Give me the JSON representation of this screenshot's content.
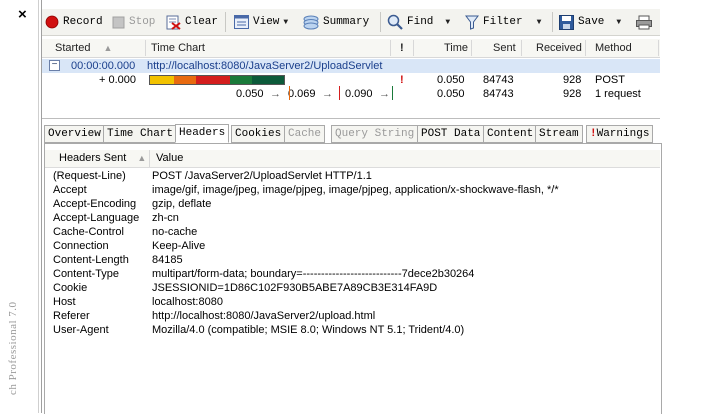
{
  "window": {
    "close_glyph": "×",
    "product_label": "ch Professional 7.0"
  },
  "toolbar": {
    "record": "Record",
    "stop": "Stop",
    "clear": "Clear",
    "view": "View",
    "summary": "Summary",
    "find": "Find",
    "filter": "Filter",
    "save": "Save"
  },
  "grid": {
    "columns": {
      "started": "Started",
      "time_chart": "Time Chart",
      "flag": "!",
      "time": "Time",
      "sent": "Sent",
      "received": "Received",
      "method": "Method"
    },
    "rows": [
      {
        "started": "00:00:00.000",
        "chart": "http://localhost:8080/JavaServer2/UploadServlet",
        "flag": "",
        "time": "",
        "sent": "",
        "received": "",
        "method": "",
        "toggle": "−"
      },
      {
        "started": "+ 0.000",
        "chart": "",
        "flag": "!",
        "time": "0.050",
        "sent": "84743",
        "received": "928",
        "method": "POST"
      },
      {
        "started": "",
        "chart_marks": [
          "0.050",
          "0.069",
          "0.090"
        ],
        "time": "0.050",
        "sent": "84743",
        "received": "928",
        "method": "1 request"
      }
    ]
  },
  "tabs": [
    {
      "label": "Overview",
      "active": false,
      "enabled": true
    },
    {
      "label": "Time Chart",
      "active": false,
      "enabled": true
    },
    {
      "label": "Headers",
      "active": true,
      "enabled": true
    },
    {
      "label": "Cookies",
      "active": false,
      "enabled": true
    },
    {
      "label": "Cache",
      "active": false,
      "enabled": false
    },
    {
      "label": "Query String",
      "active": false,
      "enabled": false
    },
    {
      "label": "POST Data",
      "active": false,
      "enabled": true
    },
    {
      "label": "Content",
      "active": false,
      "enabled": true
    },
    {
      "label": "Stream",
      "active": false,
      "enabled": true
    },
    {
      "label": "Warnings",
      "active": false,
      "enabled": true
    }
  ],
  "headers_pane": {
    "col_name": "Headers Sent",
    "col_value": "Value",
    "rows": [
      {
        "name": "(Request-Line)",
        "value": "POST /JavaServer2/UploadServlet HTTP/1.1"
      },
      {
        "name": "Accept",
        "value": "image/gif, image/jpeg, image/pjpeg, image/pjpeg, application/x-shockwave-flash, */*"
      },
      {
        "name": "Accept-Encoding",
        "value": "gzip, deflate"
      },
      {
        "name": "Accept-Language",
        "value": "zh-cn"
      },
      {
        "name": "Cache-Control",
        "value": "no-cache"
      },
      {
        "name": "Connection",
        "value": "Keep-Alive"
      },
      {
        "name": "Content-Length",
        "value": "84185"
      },
      {
        "name": "Content-Type",
        "value": "multipart/form-data; boundary=---------------------------7dece2b30264"
      },
      {
        "name": "Cookie",
        "value": "JSESSIONID=1D86C102F930B5ABE7A89CB3E314FA9D"
      },
      {
        "name": "Host",
        "value": "localhost:8080"
      },
      {
        "name": "Referer",
        "value": "http://localhost:8080/JavaServer2/upload.html"
      },
      {
        "name": "User-Agent",
        "value": "Mozilla/4.0 (compatible; MSIE 8.0; Windows NT 5.1; Trident/4.0)"
      }
    ]
  },
  "colors": {
    "selected_row": "#d9e6f7",
    "record_red": "#d01010",
    "warning_red": "#d01010",
    "timing_segments": [
      "#ffffff",
      "#f2c200",
      "#e86a10",
      "#d41e1e",
      "#1a7a3a",
      "#0c5a3a"
    ]
  }
}
